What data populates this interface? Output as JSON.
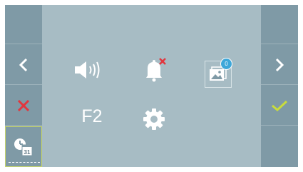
{
  "left_panel": {
    "back_icon": "chevron-left-icon",
    "cancel_icon": "x-icon",
    "calendar_icon": "clock-calendar-icon",
    "calendar_day": "31"
  },
  "right_panel": {
    "forward_icon": "chevron-right-icon",
    "confirm_icon": "check-icon"
  },
  "main": {
    "volume_icon": "speaker-volume-icon",
    "bell_icon": "bell-muted-icon",
    "gallery_icon": "image-gallery-icon",
    "gallery_badge": "0",
    "f2_label": "F2",
    "settings_icon": "gear-icon"
  },
  "colors": {
    "background": "#a7bcc4",
    "side_column": "#7f9aa6",
    "icon": "#ffffff",
    "cancel": "#e2363e",
    "confirm": "#c9dc3c",
    "badge": "#3da7d9"
  }
}
